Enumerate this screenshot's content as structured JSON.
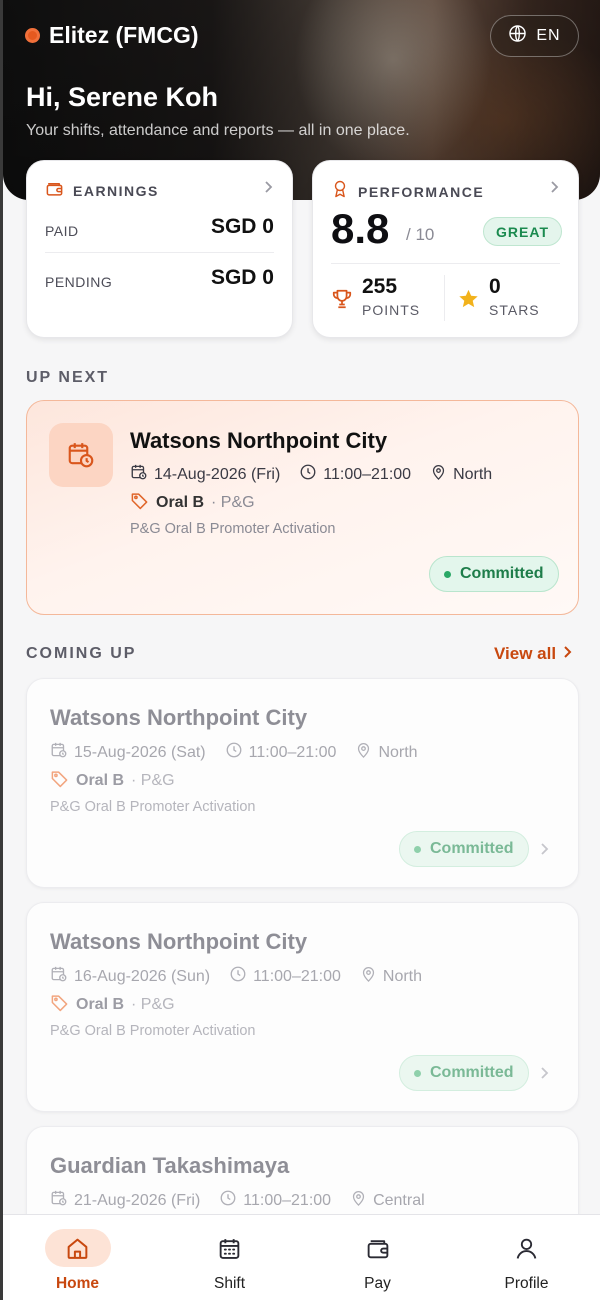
{
  "header": {
    "brand": "Elitez (FMCG)",
    "language": "EN",
    "greeting": "Hi, Serene Koh",
    "subtitle": "Your shifts, attendance and reports — all in one place."
  },
  "earnings": {
    "title": "EARNINGS",
    "paid_label": "PAID",
    "paid_value": "SGD 0",
    "pending_label": "PENDING",
    "pending_value": "SGD 0"
  },
  "performance": {
    "title": "PERFORMANCE",
    "score": "8.8",
    "score_of": "/ 10",
    "badge": "GREAT",
    "points_value": "255",
    "points_label": "POINTS",
    "stars_value": "0",
    "stars_label": "STARS"
  },
  "up_next": {
    "section_label": "UP NEXT",
    "title": "Watsons Northpoint City",
    "date": "14-Aug-2026 (Fri)",
    "time": "11:00–21:00",
    "region": "North",
    "brand": "Oral B",
    "client": "· P&G",
    "description": "P&G Oral B Promoter Activation",
    "status": "Committed"
  },
  "coming_up": {
    "section_label": "COMING UP",
    "view_all": "View all",
    "shifts": [
      {
        "title": "Watsons Northpoint City",
        "date": "15-Aug-2026 (Sat)",
        "time": "11:00–21:00",
        "region": "North",
        "brand": "Oral B",
        "client": "· P&G",
        "description": "P&G Oral B Promoter Activation",
        "status": "Committed"
      },
      {
        "title": "Watsons Northpoint City",
        "date": "16-Aug-2026 (Sun)",
        "time": "11:00–21:00",
        "region": "North",
        "brand": "Oral B",
        "client": "· P&G",
        "description": "P&G Oral B Promoter Activation",
        "status": "Committed"
      },
      {
        "title": "Guardian Takashimaya",
        "date": "21-Aug-2026 (Fri)",
        "time": "11:00–21:00",
        "region": "Central"
      }
    ]
  },
  "nav": {
    "items": [
      {
        "label": "Home",
        "icon": "home-icon",
        "active": true
      },
      {
        "label": "Shift",
        "icon": "calendar-icon"
      },
      {
        "label": "Pay",
        "icon": "wallet-icon"
      },
      {
        "label": "Profile",
        "icon": "user-icon"
      }
    ]
  },
  "colors": {
    "accent": "#c8480f",
    "brand_dot": "#e5591f",
    "success": "#1b8a4f",
    "star": "#f2b21b"
  }
}
